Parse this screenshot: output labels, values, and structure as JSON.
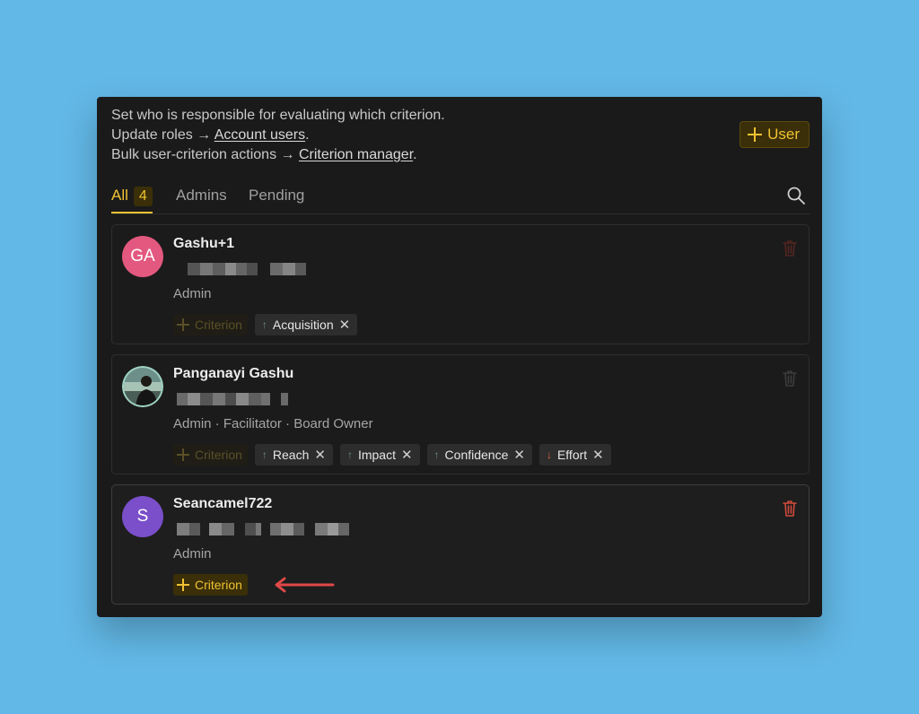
{
  "intro": {
    "line1": "Set who is responsible for evaluating which criterion.",
    "line2_prefix": "Update roles →",
    "line2_link": "Account users",
    "line3_prefix": "Bulk user-criterion actions →",
    "line3_link": "Criterion manager",
    "period": "."
  },
  "add_user_label": "User",
  "tabs": {
    "all": "All",
    "all_count": "4",
    "admins": "Admins",
    "pending": "Pending"
  },
  "users": [
    {
      "initials": "GA",
      "name": "Gashu+1",
      "role": "Admin",
      "add_criterion": "Criterion",
      "criteria": [
        {
          "label": "Acquisition",
          "arrow": "↑"
        }
      ]
    },
    {
      "name": "Panganayi Gashu",
      "role": "Admin · Facilitator · Board Owner",
      "add_criterion": "Criterion",
      "criteria": [
        {
          "label": "Reach",
          "arrow": "↑"
        },
        {
          "label": "Impact",
          "arrow": "↑"
        },
        {
          "label": "Confidence",
          "arrow": "↑"
        },
        {
          "label": "Effort",
          "arrow": "↓"
        }
      ]
    },
    {
      "initials": "S",
      "name": "Seancamel722",
      "role": "Admin",
      "add_criterion": "Criterion",
      "criteria": []
    }
  ],
  "remove_symbol": "✕",
  "colors": {
    "background": "#62b8e6",
    "panel": "#1a1a1a",
    "accent": "#f1c232",
    "avatar_ga": "#e3587f",
    "avatar_s": "#7a4fc9",
    "danger": "#c0392b",
    "annotation_arrow": "#e04848"
  }
}
